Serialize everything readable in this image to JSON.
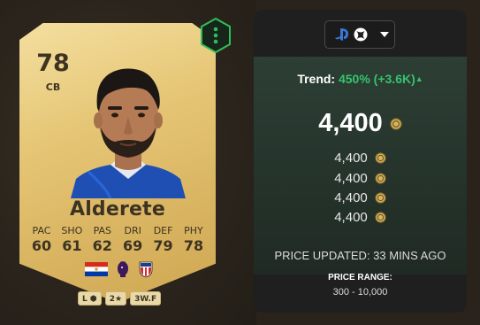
{
  "card": {
    "rating": "78",
    "position": "CB",
    "name": "Alderete",
    "stats": [
      {
        "label": "PAC",
        "value": "60"
      },
      {
        "label": "SHO",
        "value": "61"
      },
      {
        "label": "PAS",
        "value": "62"
      },
      {
        "label": "DRI",
        "value": "69"
      },
      {
        "label": "DEF",
        "value": "79"
      },
      {
        "label": "PHY",
        "value": "78"
      }
    ],
    "nation_icon": "paraguay-flag-icon",
    "league_icon": "premier-league-icon",
    "club_icon": "sunderland-crest-icon",
    "chips": {
      "foot": "L",
      "skill_moves": "2★",
      "weak_foot": "3W.F"
    },
    "more_icon": "vertical-dots-icon"
  },
  "panel": {
    "platform_icons": [
      "playstation-icon",
      "xbox-icon"
    ],
    "trend_label": "Trend:",
    "trend_value": "450% (+3.6K)",
    "trend_arrow": "▲",
    "main_price": "4,400",
    "prices": [
      "4,400",
      "4,400",
      "4,400",
      "4,400"
    ],
    "updated": "PRICE UPDATED: 33 MINS AGO",
    "range_label": "PRICE RANGE:",
    "range_value": "300 - 10,000"
  },
  "colors": {
    "trend_green": "#35c46c",
    "card_gold": "#e6c777",
    "accent_hex": "#2fbf5a"
  }
}
